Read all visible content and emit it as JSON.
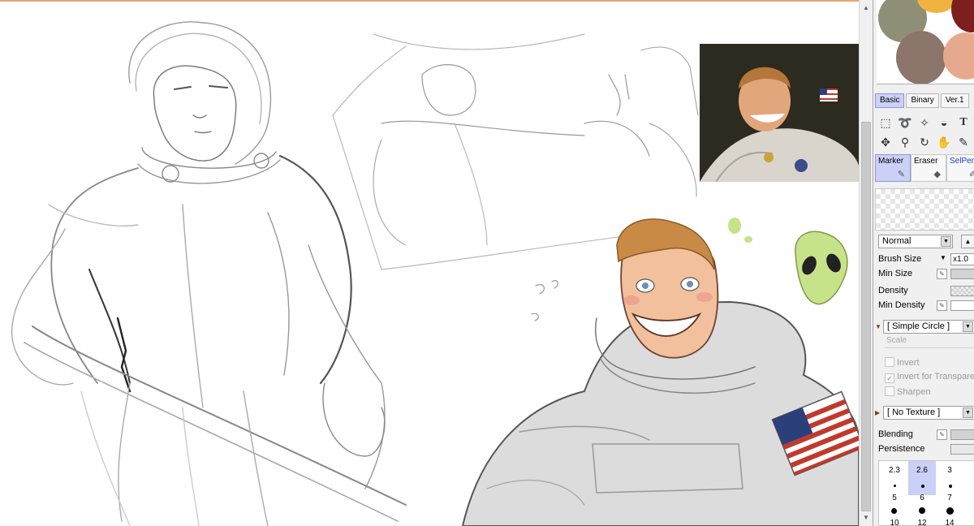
{
  "panel": {
    "palette_colors": [
      "#8f8f78",
      "#efb43f",
      "#7d1f1d",
      "#8c756a",
      "#e7a98d"
    ],
    "tabs": [
      "Basic",
      "Binary",
      "Ver.1"
    ],
    "tools": [
      "rect-select-icon",
      "lasso-icon",
      "magic-wand-icon",
      "fill-icon",
      "text-icon",
      "move-icon",
      "zoom-icon",
      "rotate-icon",
      "hand-icon",
      "eyedropper-icon"
    ],
    "brushes": [
      {
        "label": "Marker",
        "active": true
      },
      {
        "label": "Eraser",
        "active": false
      },
      {
        "label": "SelPen",
        "active": false
      }
    ],
    "blend_mode": "Normal",
    "brush_size_label": "Brush Size",
    "brush_size_value": "x1.0",
    "min_size_label": "Min Size",
    "density_label": "Density",
    "min_density_label": "Min Density",
    "shape": "[ Simple Circle ]",
    "scale_label": "Scale",
    "invert_label": "Invert",
    "invert_transparency_label": "Invert for Transparency",
    "sharpen_label": "Sharpen",
    "texture": "[ No Texture ]",
    "blending_label": "Blending",
    "persistence_label": "Persistence",
    "sizes_row1": [
      "2.3",
      "2.6",
      "3"
    ],
    "sizes_row2": [
      "5",
      "6",
      "7"
    ],
    "sizes_row3": [
      "10",
      "12",
      "14"
    ],
    "selected_size": "2.6"
  },
  "colors": {
    "accent_line": "#e7a86f",
    "selection": "#cbd0f6",
    "alien_green": "#c7e38a",
    "skin": "#f2c09c",
    "hair": "#c98a45",
    "suit": "#dcdcdc"
  }
}
